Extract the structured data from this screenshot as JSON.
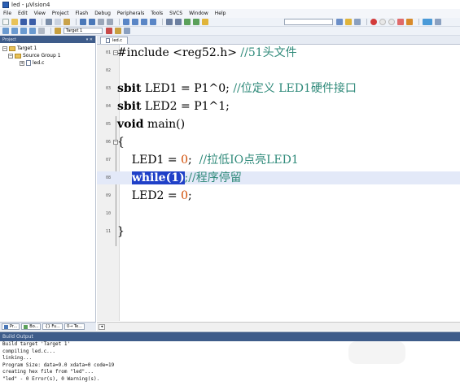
{
  "window": {
    "title": "led - µVision4"
  },
  "menu": [
    "File",
    "Edit",
    "View",
    "Project",
    "Flash",
    "Debug",
    "Peripherals",
    "Tools",
    "SVCS",
    "Window",
    "Help"
  ],
  "toolbar": {
    "target": "Target 1"
  },
  "project": {
    "header": "Project",
    "controls": "▾ ✕",
    "target": "Target 1",
    "group": "Source Group 1",
    "file": "led.c",
    "tabs": [
      "Pr...",
      "Bo...",
      "{} Fu...",
      "0→ Te..."
    ]
  },
  "editor": {
    "tab": "led.c",
    "line_numbers": [
      "01",
      "02",
      "03",
      "04",
      "05",
      "06",
      "07",
      "08",
      "09",
      "10",
      "11"
    ],
    "lines": {
      "l1": "#include <reg52.h> ",
      "l1_comment": "//51头文件",
      "l3_kw": "sbit",
      "l3_code": " LED1 = P1^0; ",
      "l3_comment": "//位定义 LED1硬件接口",
      "l4_kw": "sbit",
      "l4_code": " LED2 = P1^1;",
      "l5_kw": "void",
      "l5_code": " main()",
      "l6": "{",
      "l7_code": "    LED1 = ",
      "l7_num": "0",
      "l7_semi": ";  ",
      "l7_comment": "//拉低IO点亮LED1",
      "l8_indent": "    ",
      "l8_sel": "while(1)",
      "l8_rest": ";//程序停留",
      "l9_code": "    LED2 = ",
      "l9_num": "0",
      "l9_semi": ";",
      "l11": "}"
    }
  },
  "build": {
    "header": "Build Output",
    "lines": [
      "Build target 'Target 1'",
      "compiling led.c...",
      "linking...",
      "Program Size: data=9.0 xdata=0 code=19",
      "creating hex file from \"led\"...",
      "\"led\" - 0 Error(s), 0 Warning(s)."
    ]
  }
}
